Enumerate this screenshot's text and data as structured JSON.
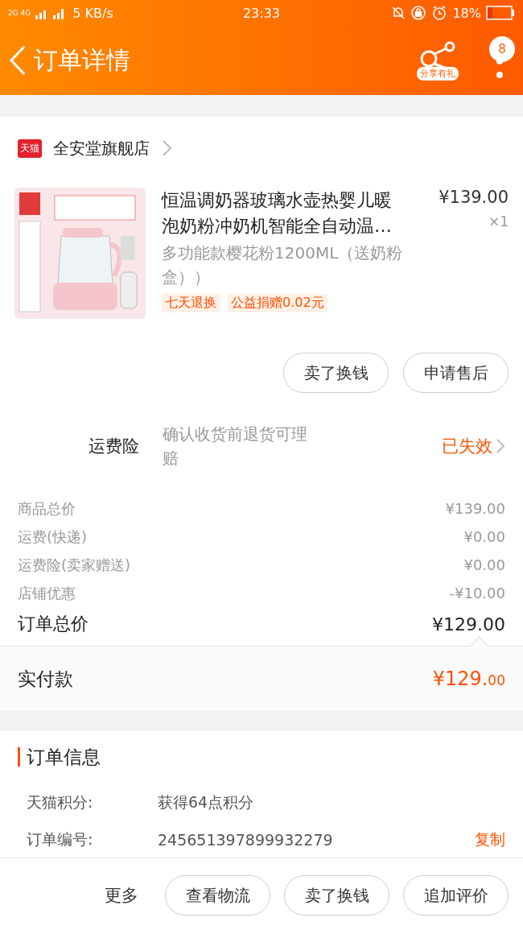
{
  "status_bar": {
    "network": "2G 4G",
    "speed": "5 KB/s",
    "time": "23:33",
    "battery": "18%"
  },
  "header": {
    "title": "订单详情",
    "share_label": "分享有礼",
    "badge": "8"
  },
  "store": {
    "badge": "天猫",
    "name": "全安堂旗舰店"
  },
  "product": {
    "kind": "picture",
    "title": "恒温调奶器玻璃水壶热婴儿暖泡奶粉冲奶机智能全自动温…",
    "variant": "多功能款樱花粉1200ML（送奶粉盒））",
    "price": "¥139.00",
    "quantity": "×1",
    "tags": [
      "七天退换",
      "公益捐赠0.02元"
    ]
  },
  "item_actions": [
    "卖了换钱",
    "申请售后"
  ],
  "freight_insurance": {
    "label": "运费险",
    "description": "确认收货前退货可理赔",
    "status": "已失效"
  },
  "price_rows": [
    {
      "kind": "detail",
      "label": "商品总价",
      "value": "¥139.00"
    },
    {
      "kind": "detail",
      "label": "运费(快递)",
      "value": "¥0.00"
    },
    {
      "kind": "detail",
      "label": "运费险(卖家赠送)",
      "value": "¥0.00"
    },
    {
      "kind": "detail",
      "label": "店铺优惠",
      "value": "-¥10.00"
    },
    {
      "kind": "total",
      "label": "订单总价",
      "value": "¥129.00"
    }
  ],
  "payment": {
    "label": "实付款",
    "amount": "¥129.",
    "cents": "00"
  },
  "order_info": {
    "title": "订单信息",
    "rows": [
      {
        "label": "天猫积分:",
        "value": "获得64点积分"
      },
      {
        "label": "订单编号:",
        "value": "245651397899932279",
        "action": "复制"
      }
    ]
  },
  "bottom_bar": {
    "more": "更多",
    "buttons": [
      "查看物流",
      "卖了换钱",
      "追加评价"
    ]
  }
}
